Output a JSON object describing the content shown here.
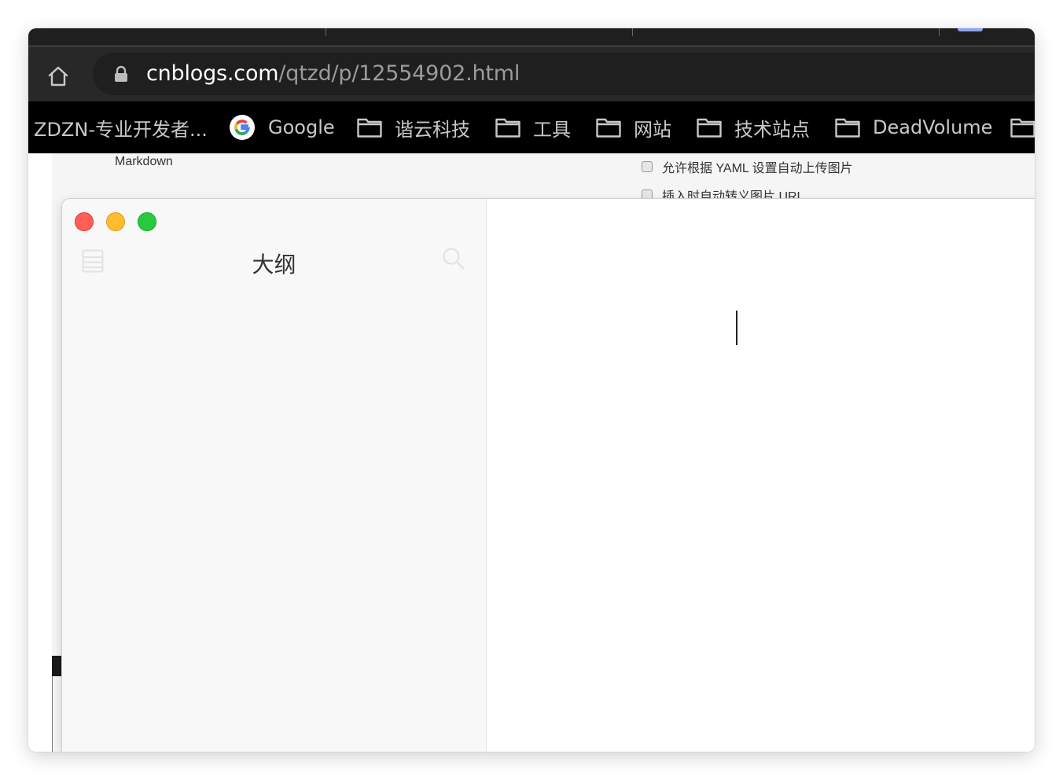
{
  "browser": {
    "address": {
      "host": "cnblogs.com",
      "path": "/qtzd/p/12554902.html"
    },
    "bookmarks": [
      {
        "label": "ZDZN-专业开发者...",
        "icon": "none"
      },
      {
        "label": "Google",
        "icon": "google-icon"
      },
      {
        "label": "谐云科技",
        "icon": "folder-icon"
      },
      {
        "label": "工具",
        "icon": "folder-icon"
      },
      {
        "label": "网站",
        "icon": "folder-icon"
      },
      {
        "label": "技术站点",
        "icon": "folder-icon"
      },
      {
        "label": "DeadVolume",
        "icon": "folder-icon"
      }
    ]
  },
  "background_page": {
    "markdown_label": "Markdown",
    "options": [
      {
        "label": "允许根据 YAML 设置自动上传图片",
        "checked": false
      },
      {
        "label": "插入时自动转义图片 URL",
        "checked": false
      }
    ]
  },
  "app": {
    "sidebar": {
      "title": "大纲",
      "toggle_icon": "sidebar-list-icon",
      "search_icon": "search-icon"
    },
    "editor": {
      "content": ""
    }
  },
  "colors": {
    "traffic_red": "#fe5f57",
    "traffic_yellow": "#febc2e",
    "traffic_green": "#28c840",
    "bookmark_bar": "#000000",
    "toolbar": "#282828"
  }
}
